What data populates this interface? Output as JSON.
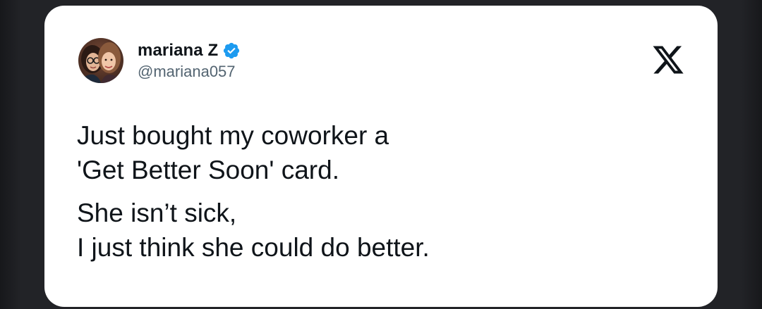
{
  "tweet": {
    "author": {
      "display_name": "mariana Z",
      "handle": "@mariana057",
      "verified": true,
      "avatar": "profile-photo-two-women"
    },
    "platform_icon": "x-logo-icon",
    "paragraphs": [
      [
        "Just bought my coworker a",
        "'Get Better Soon' card."
      ],
      [
        "She isn’t sick,",
        "I just think she could do better."
      ]
    ]
  },
  "colors": {
    "card_background": "#ffffff",
    "text_primary": "#0f1419",
    "text_secondary": "#536471",
    "verified_badge": "#1d9bf0",
    "page_background": "#1d1e22"
  }
}
